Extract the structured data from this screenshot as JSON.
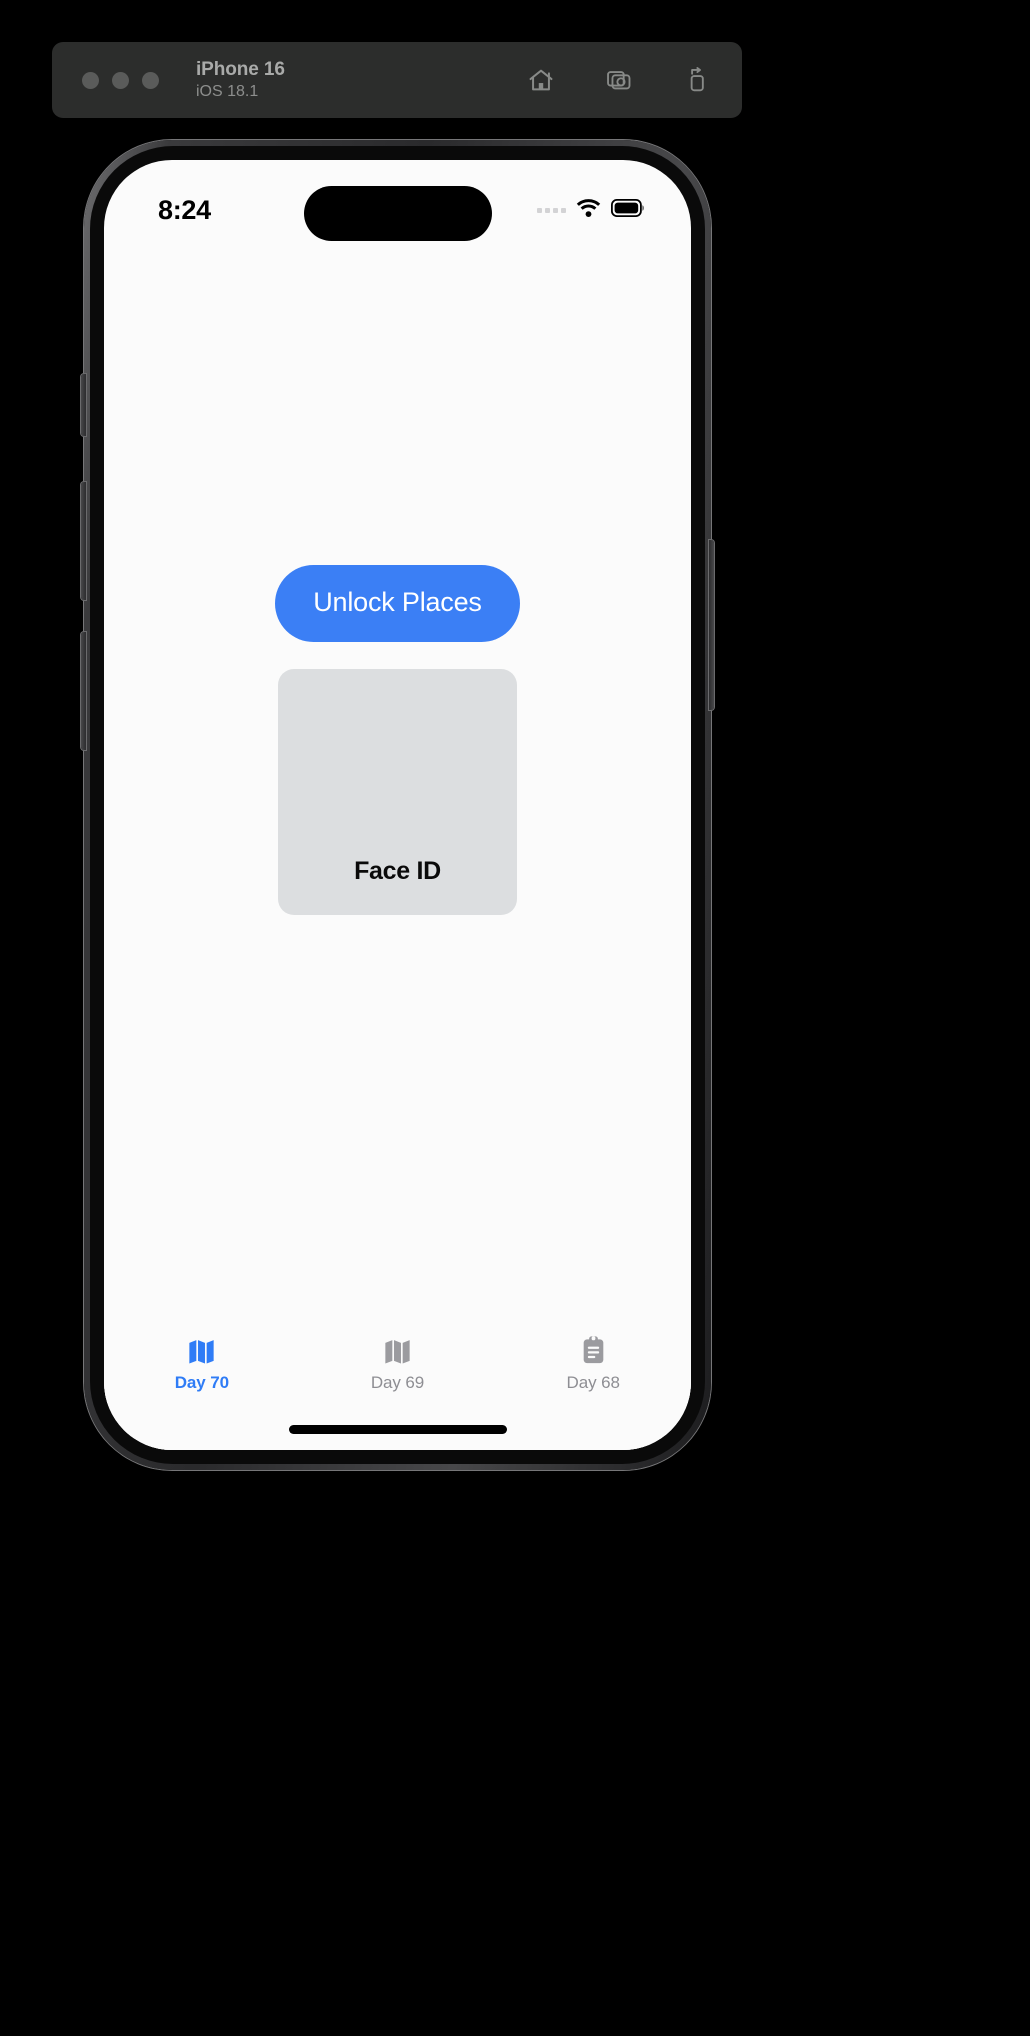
{
  "simulator": {
    "device_name": "iPhone 16",
    "os_version": "iOS 18.1",
    "window_controls": [
      "close",
      "minimize",
      "zoom"
    ],
    "toolbar_buttons": [
      {
        "name": "home-icon",
        "label": "Home"
      },
      {
        "name": "screenshot-icon",
        "label": "Screenshot"
      },
      {
        "name": "rotate-device-icon",
        "label": "Rotate"
      }
    ]
  },
  "status_bar": {
    "time": "8:24",
    "signal_icon": "cellular-signal-icon",
    "wifi_icon": "wifi-icon",
    "battery_icon": "battery-icon"
  },
  "screen": {
    "unlock_button_label": "Unlock Places",
    "faceid_card_label": "Face ID"
  },
  "tab_bar": {
    "items": [
      {
        "label": "Day 70",
        "icon": "map-icon",
        "active": true
      },
      {
        "label": "Day 69",
        "icon": "map-icon",
        "active": false
      },
      {
        "label": "Day 68",
        "icon": "clipboard-icon",
        "active": false
      }
    ]
  },
  "colors": {
    "accent_blue": "#3b7ff5",
    "tab_active_blue": "#2f7cf6",
    "tab_inactive_gray": "#8e8e93",
    "card_gray": "#dcdee0",
    "screen_background": "#fbfbfb",
    "titlebar_background": "#2c2d2c"
  }
}
